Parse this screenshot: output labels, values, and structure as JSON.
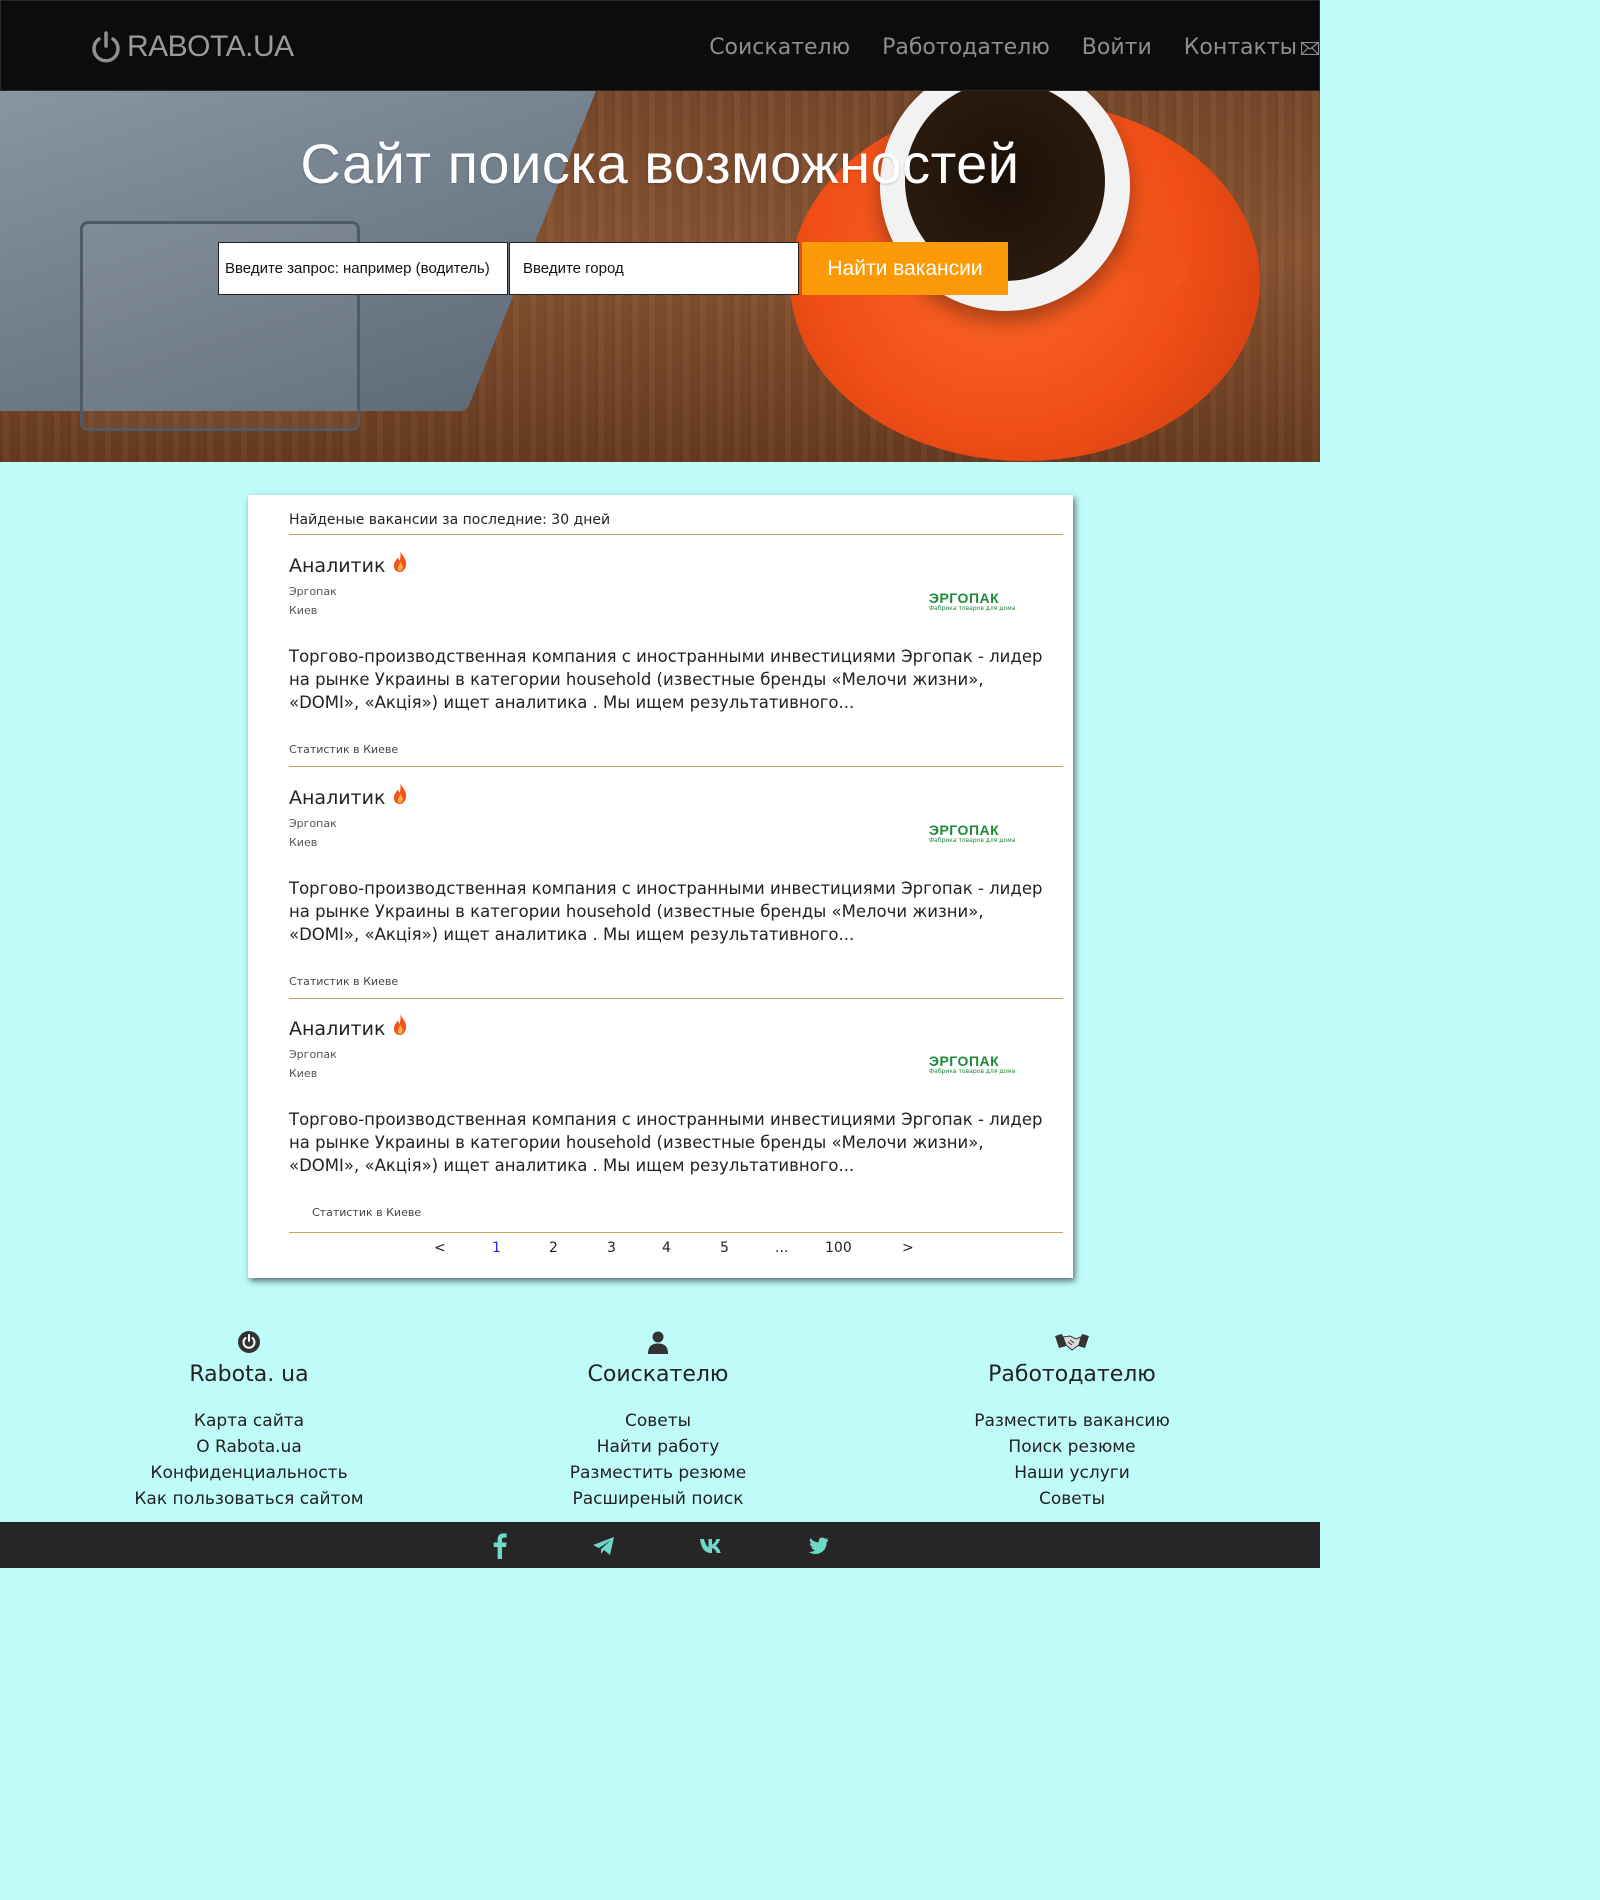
{
  "header": {
    "logo_text": "RABOTA.UA",
    "nav": [
      "Соискателю",
      "Работодателю",
      "Войти",
      "Контакты"
    ]
  },
  "hero": {
    "title": "Сайт поиска возможностей",
    "query_placeholder": "Введите запрос: например (водитель)",
    "city_placeholder": "Введите город",
    "search_button": "Найти вакансии"
  },
  "results": {
    "header": "Найденые вакансии за последние: 30 дней",
    "jobs": [
      {
        "title": "Аналитик",
        "company": "Эргопак",
        "city": "Киев",
        "logo_name": "ЭРГОПАК",
        "logo_sub": "Фабрика товаров для дома",
        "description": "Торгово-производственная компания с иностранными инвестициями Эргопак - лидер на рынке Украины в категории household (известные бренды «Мелочи жизни», «DOMI», «Акція») ищет аналитика . Мы ищем результативного...",
        "tag": "Статистик в Киеве"
      },
      {
        "title": "Аналитик",
        "company": "Эргопак",
        "city": "Киев",
        "logo_name": "ЭРГОПАК",
        "logo_sub": "Фабрика товаров для дома",
        "description": "Торгово-производственная компания с иностранными инвестициями Эргопак - лидер на рынке Украины в категории household (известные бренды «Мелочи жизни», «DOMI», «Акція») ищет аналитика . Мы ищем результативного...",
        "tag": "Статистик в Киеве"
      },
      {
        "title": "Аналитик",
        "company": "Эргопак",
        "city": "Киев",
        "logo_name": "ЭРГОПАК",
        "logo_sub": "Фабрика товаров для дома",
        "description": "Торгово-производственная компания с иностранными инвестициями Эргопак - лидер на рынке Украины в категории household (известные бренды «Мелочи жизни», «DOMI», «Акція») ищет аналитика . Мы ищем результативного...",
        "tag": "Статистик в Киеве"
      }
    ],
    "pagination": [
      "<",
      "1",
      "2",
      "3",
      "4",
      "5",
      "...",
      "100",
      ">"
    ],
    "active_page": "1"
  },
  "footer": {
    "columns": [
      {
        "icon": "power-icon",
        "title": "Rabota. ua",
        "links": [
          "Карта сайта",
          "О Rabota.ua",
          "Конфиденциальность",
          "Как пользоваться сайтом"
        ]
      },
      {
        "icon": "user-icon",
        "title": "Соискателю",
        "links": [
          "Советы",
          "Найти работу",
          "Разместить резюме",
          "Расширеный поиск"
        ]
      },
      {
        "icon": "handshake-icon",
        "title": "Работодателю",
        "links": [
          "Разместить вакансию",
          "Поиск резюме",
          "Наши услуги",
          "Советы"
        ]
      }
    ],
    "social": [
      "facebook-icon",
      "telegram-icon",
      "vk-icon",
      "twitter-icon"
    ]
  },
  "colors": {
    "accent": "#fb9a06",
    "page_bg": "#bffbf8",
    "header_bg": "#0c0c0c",
    "social_icon": "#6fd9c8",
    "logo_green": "#1d8a3a",
    "separator": "#c9a45c"
  }
}
